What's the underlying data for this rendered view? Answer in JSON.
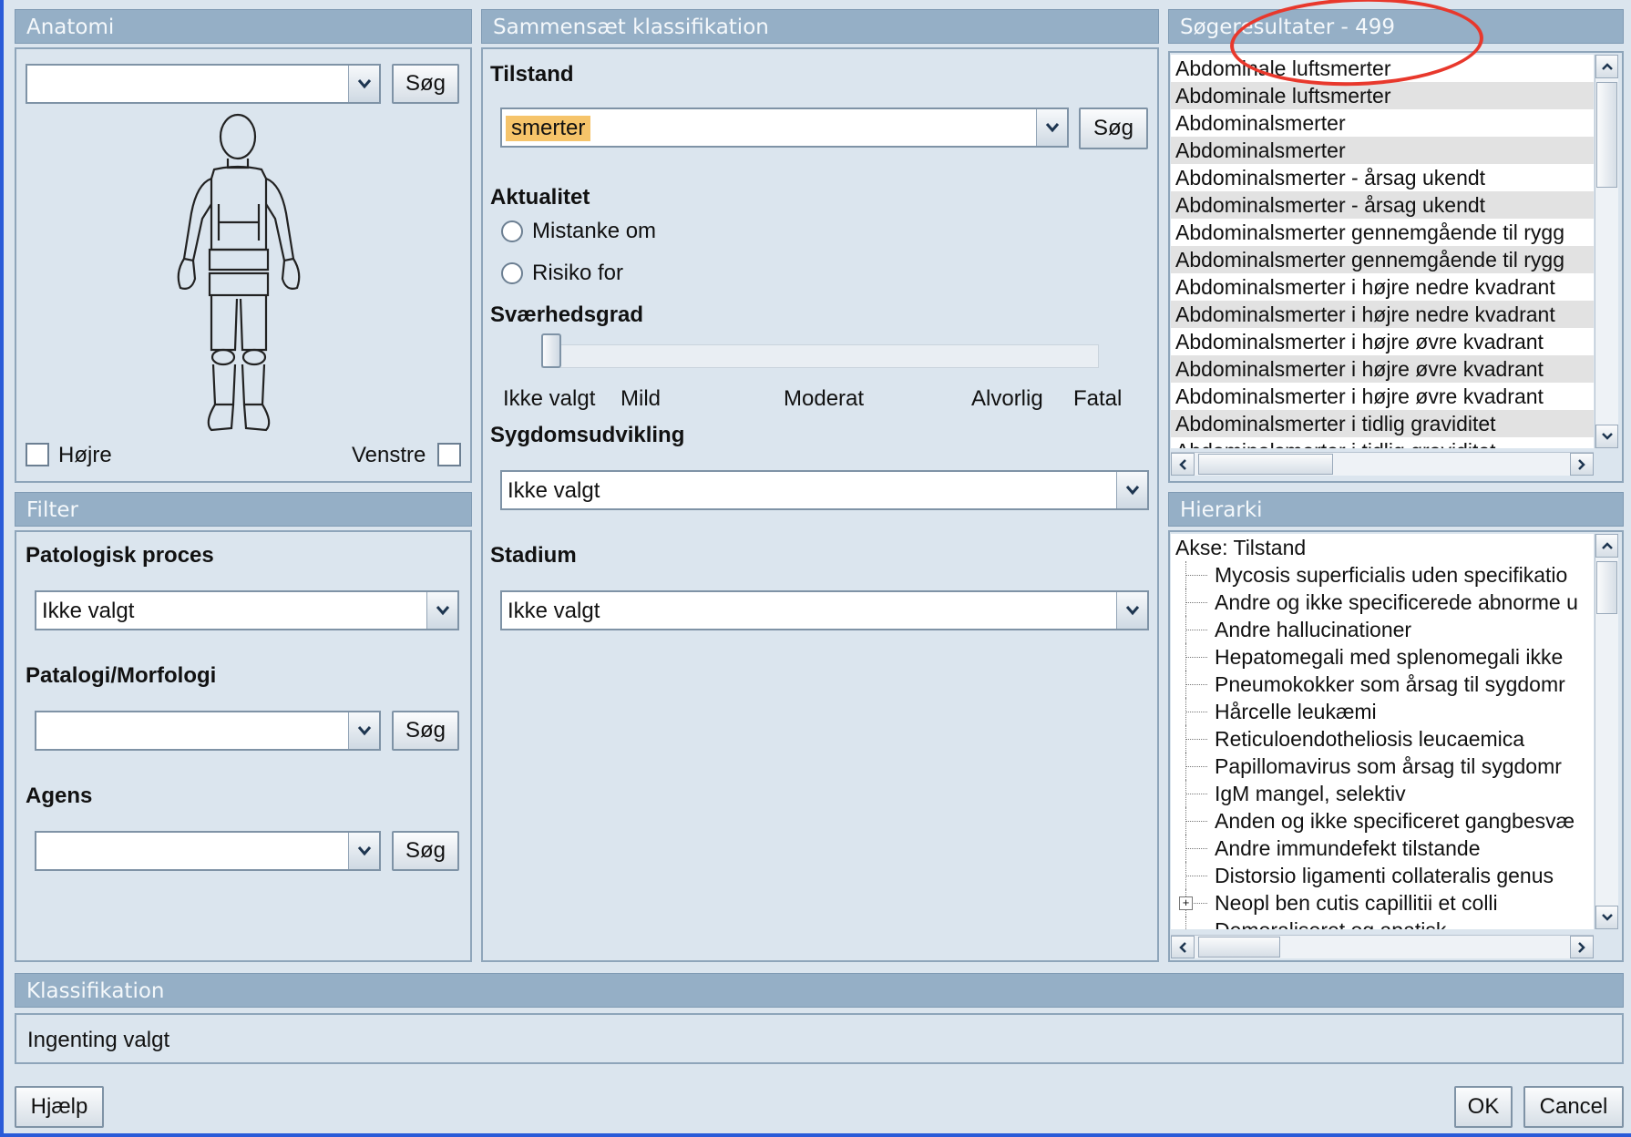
{
  "anatomy": {
    "header": "Anatomi",
    "search_value": "",
    "search_button": "Søg",
    "right_label": "Højre",
    "left_label": "Venstre"
  },
  "filter": {
    "header": "Filter",
    "pathologic_process_label": "Patologisk proces",
    "pathologic_process_value": "Ikke valgt",
    "pathology_label": "Patalogi/Morfologi",
    "pathology_value": "",
    "pathology_button": "Søg",
    "agens_label": "Agens",
    "agens_value": "",
    "agens_button": "Søg"
  },
  "compose": {
    "header": "Sammensæt klassifikation",
    "condition_label": "Tilstand",
    "condition_value": "smerter",
    "condition_button": "Søg",
    "actuality_label": "Aktualitet",
    "actuality_options": [
      "Mistanke om",
      "Risiko for"
    ],
    "severity_label": "Sværhedsgrad",
    "severity_ticks": [
      "Ikke valgt",
      "Mild",
      "Moderat",
      "Alvorlig",
      "Fatal"
    ],
    "severity_selected": "Ikke valgt",
    "development_label": "Sygdomsudvikling",
    "development_value": "Ikke valgt",
    "stage_label": "Stadium",
    "stage_value": "Ikke valgt"
  },
  "results": {
    "header": "Søgeresultater - 499",
    "items": [
      "Abdominale luftsmerter",
      "Abdominale luftsmerter",
      "Abdominalsmerter",
      "Abdominalsmerter",
      "Abdominalsmerter - årsag ukendt",
      "Abdominalsmerter - årsag ukendt",
      "Abdominalsmerter gennemgående til rygg",
      "Abdominalsmerter gennemgående til rygg",
      "Abdominalsmerter i højre nedre kvadrant",
      "Abdominalsmerter i højre nedre kvadrant",
      "Abdominalsmerter i højre øvre kvadrant",
      "Abdominalsmerter i højre øvre kvadrant",
      "Abdominalsmerter i højre øvre kvadrant",
      "Abdominalsmerter i tidlig graviditet",
      "Abdominalsmerter i tidlig graviditet"
    ]
  },
  "hierarchy": {
    "header": "Hierarki",
    "root": "Akse: Tilstand",
    "items": [
      "Mycosis superficialis uden specifikatio",
      "Andre og ikke specificerede abnorme u",
      "Andre hallucinationer",
      "Hepatomegali med splenomegali ikke",
      "Pneumokokker som årsag til sygdomr",
      "Hårcelle leukæmi",
      "Reticuloendotheliosis leucaemica",
      "Papillomavirus som årsag til sygdomr",
      "IgM mangel, selektiv",
      "Anden og ikke specificeret gangbesvæ",
      "Andre immundefekt tilstande",
      "Distorsio ligamenti collateralis genus",
      "Neopl ben cutis capillitii et colli",
      "Demoraliseret og apatisk"
    ]
  },
  "classification": {
    "header": "Klassifikation",
    "value": "Ingenting valgt"
  },
  "footer": {
    "help_button": "Hjælp",
    "ok_button": "OK",
    "cancel_button": "Cancel"
  },
  "colors": {
    "header_bg": "#95afc6",
    "panel_bg": "#dbe5ee",
    "highlight": "#f6c46a",
    "annotation": "#e8382c",
    "window_border": "#2a5bd8"
  },
  "icons": [
    "chevron-down-icon",
    "scroll-up-icon",
    "scroll-down-icon",
    "scroll-left-icon",
    "scroll-right-icon",
    "human-body-icon",
    "tree-expand-icon"
  ]
}
